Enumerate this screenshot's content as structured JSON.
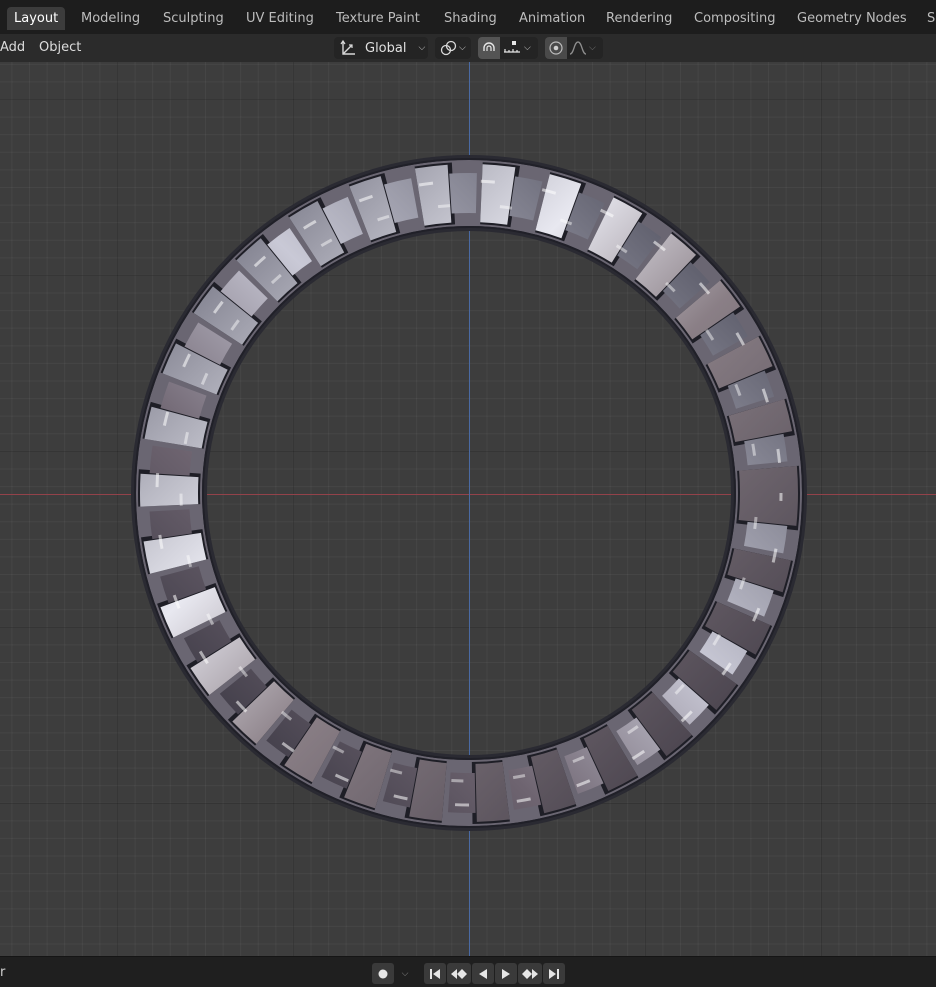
{
  "workspace_tabs": [
    {
      "label": "Layout",
      "active": true
    },
    {
      "label": "Modeling",
      "active": false
    },
    {
      "label": "Sculpting",
      "active": false
    },
    {
      "label": "UV Editing",
      "active": false
    },
    {
      "label": "Texture Paint",
      "active": false
    },
    {
      "label": "Shading",
      "active": false
    },
    {
      "label": "Animation",
      "active": false
    },
    {
      "label": "Rendering",
      "active": false
    },
    {
      "label": "Compositing",
      "active": false
    },
    {
      "label": "Geometry Nodes",
      "active": false
    },
    {
      "label": "S",
      "active": false
    }
  ],
  "header": {
    "menu": {
      "add": "Add",
      "object": "Object"
    },
    "transform_orientation": "Global",
    "icons": [
      "transform-orientation-icon",
      "pivot-point-icon",
      "snap-magnet-icon",
      "snap-increment-icon",
      "proportional-editing-icon",
      "falloff-curve-icon"
    ],
    "snap_enabled": true
  },
  "viewport": {
    "axis_colors": {
      "x": "#93424a",
      "y": "#4a6aa3"
    },
    "object": "twisted-braided-ring"
  },
  "footer": {
    "left_text": "r",
    "playback_icons": [
      "record-dot-icon",
      "chevron-down-icon",
      "jump-to-start-icon",
      "prev-keyframe-icon",
      "play-reverse-icon",
      "play-icon",
      "next-keyframe-icon",
      "jump-to-end-icon"
    ]
  },
  "colors": {
    "accent_active_tab": "#3c3c3c",
    "viewport_bg": "#3d3d3d",
    "metal_highlight": "#e8e8f0",
    "metal_shadow": "#2a2a35"
  }
}
